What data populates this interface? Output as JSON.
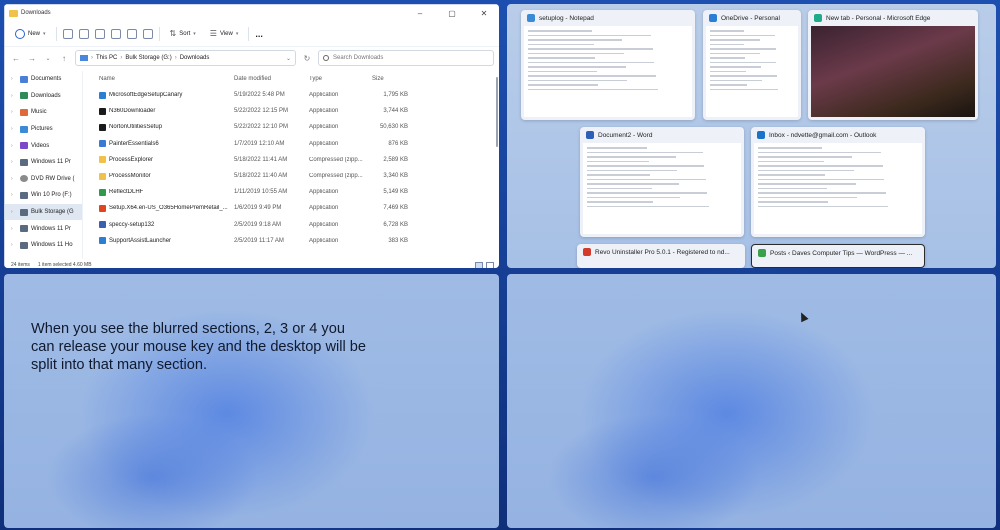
{
  "explorer": {
    "window_title": "Downloads",
    "toolbar": {
      "new": "New",
      "sort": "Sort",
      "view": "View",
      "more": "..."
    },
    "breadcrumb": [
      "This PC",
      "Bulk Storage (G:)",
      "Downloads"
    ],
    "search_placeholder": "Search Downloads",
    "nav_items": [
      {
        "label": "Documents",
        "icon": "documents-icon",
        "color": "#4a7fd6"
      },
      {
        "label": "Downloads",
        "icon": "downloads-icon",
        "color": "#2e8b57"
      },
      {
        "label": "Music",
        "icon": "music-icon",
        "color": "#e0683a"
      },
      {
        "label": "Pictures",
        "icon": "pictures-icon",
        "color": "#3a8ad6"
      },
      {
        "label": "Videos",
        "icon": "videos-icon",
        "color": "#7a48c9"
      },
      {
        "label": "Windows 11 Pr",
        "icon": "drive-icon",
        "color": "#5a6a80"
      },
      {
        "label": "DVD RW Drive (",
        "icon": "dvd-icon",
        "color": "#8a8a8a"
      },
      {
        "label": "Win 10 Pro (F:)",
        "icon": "drive-icon",
        "color": "#5a6a80"
      },
      {
        "label": "Bulk Storage (G",
        "icon": "drive-icon",
        "color": "#5a6a80"
      },
      {
        "label": "Windows 11 Pr",
        "icon": "drive-icon",
        "color": "#5a6a80"
      },
      {
        "label": "Windows 11 Ho",
        "icon": "drive-icon",
        "color": "#5a6a80"
      }
    ],
    "columns": {
      "name": "Name",
      "date": "Date modified",
      "type": "Type",
      "size": "Size"
    },
    "files": [
      {
        "name": "MicrosoftEdgeSetupCanary",
        "date": "5/19/2022 5:48 PM",
        "type": "Application",
        "size": "1,795 KB",
        "icon_color": "#2a7fd4"
      },
      {
        "name": "N360Downloader",
        "date": "5/22/2022 12:15 PM",
        "type": "Application",
        "size": "3,744 KB",
        "icon_color": "#1a1a1a"
      },
      {
        "name": "NortonUtilitiesSetup",
        "date": "5/22/2022 12:10 PM",
        "type": "Application",
        "size": "50,630 KB",
        "icon_color": "#1a1a1a"
      },
      {
        "name": "PainterEssentials6",
        "date": "1/7/2019 12:10 AM",
        "type": "Application",
        "size": "876 KB",
        "icon_color": "#3a7ad6"
      },
      {
        "name": "ProcessExplorer",
        "date": "5/18/2022 11:41 AM",
        "type": "Compressed (zipp...",
        "size": "2,589 KB",
        "icon_color": "#f1c24b"
      },
      {
        "name": "ProcessMonitor",
        "date": "5/18/2022 11:40 AM",
        "type": "Compressed (zipp...",
        "size": "3,340 KB",
        "icon_color": "#f1c24b"
      },
      {
        "name": "ReflectDLHF",
        "date": "1/11/2019 10:55 AM",
        "type": "Application",
        "size": "5,149 KB",
        "icon_color": "#2e9a4a"
      },
      {
        "name": "Setup.X64.en-US_O365HomePremRetail_...",
        "date": "1/6/2019 9:49 PM",
        "type": "Application",
        "size": "7,469 KB",
        "icon_color": "#e0451e"
      },
      {
        "name": "speccy-setup132",
        "date": "2/5/2019 9:18 AM",
        "type": "Application",
        "size": "6,728 KB",
        "icon_color": "#3a5fb0"
      },
      {
        "name": "SupportAssistLauncher",
        "date": "2/5/2019 11:17 AM",
        "type": "Application",
        "size": "383 KB",
        "icon_color": "#2a7fd4"
      }
    ],
    "status": {
      "count": "24 items",
      "selected": "1 item selected  4.60 MB"
    }
  },
  "snap_assist": [
    {
      "title": "setuplog - Notepad",
      "icon": "notepad-icon",
      "icon_color": "#3a8ad6",
      "content": "text"
    },
    {
      "title": "OneDrive - Personal",
      "icon": "onedrive-icon",
      "icon_color": "#2a7fd4",
      "content": "text"
    },
    {
      "title": "New tab - Personal - Microsoft Edge",
      "icon": "edge-icon",
      "icon_color": "#1faa8a",
      "content": "image"
    },
    {
      "title": "Document2 - Word",
      "icon": "word-icon",
      "icon_color": "#2b5fb8",
      "content": "text"
    },
    {
      "title": "Inbox - ndvette@gmail.com - Outlook",
      "icon": "outlook-icon",
      "icon_color": "#1a73c9",
      "content": "text"
    },
    {
      "title": "Revo Uninstaller Pro 5.0.1 - Registered to nd...",
      "icon": "revo-icon",
      "icon_color": "#d43a2a",
      "content": "none"
    },
    {
      "title": "Posts ‹ Daves Computer Tips — WordPress — ...",
      "icon": "chrome-icon",
      "icon_color": "#3aa04a",
      "content": "none"
    }
  ],
  "instruction_text": "When you see the blurred sections, 2, 3 or 4 you can release your mouse key and the desktop will be split into that many section."
}
